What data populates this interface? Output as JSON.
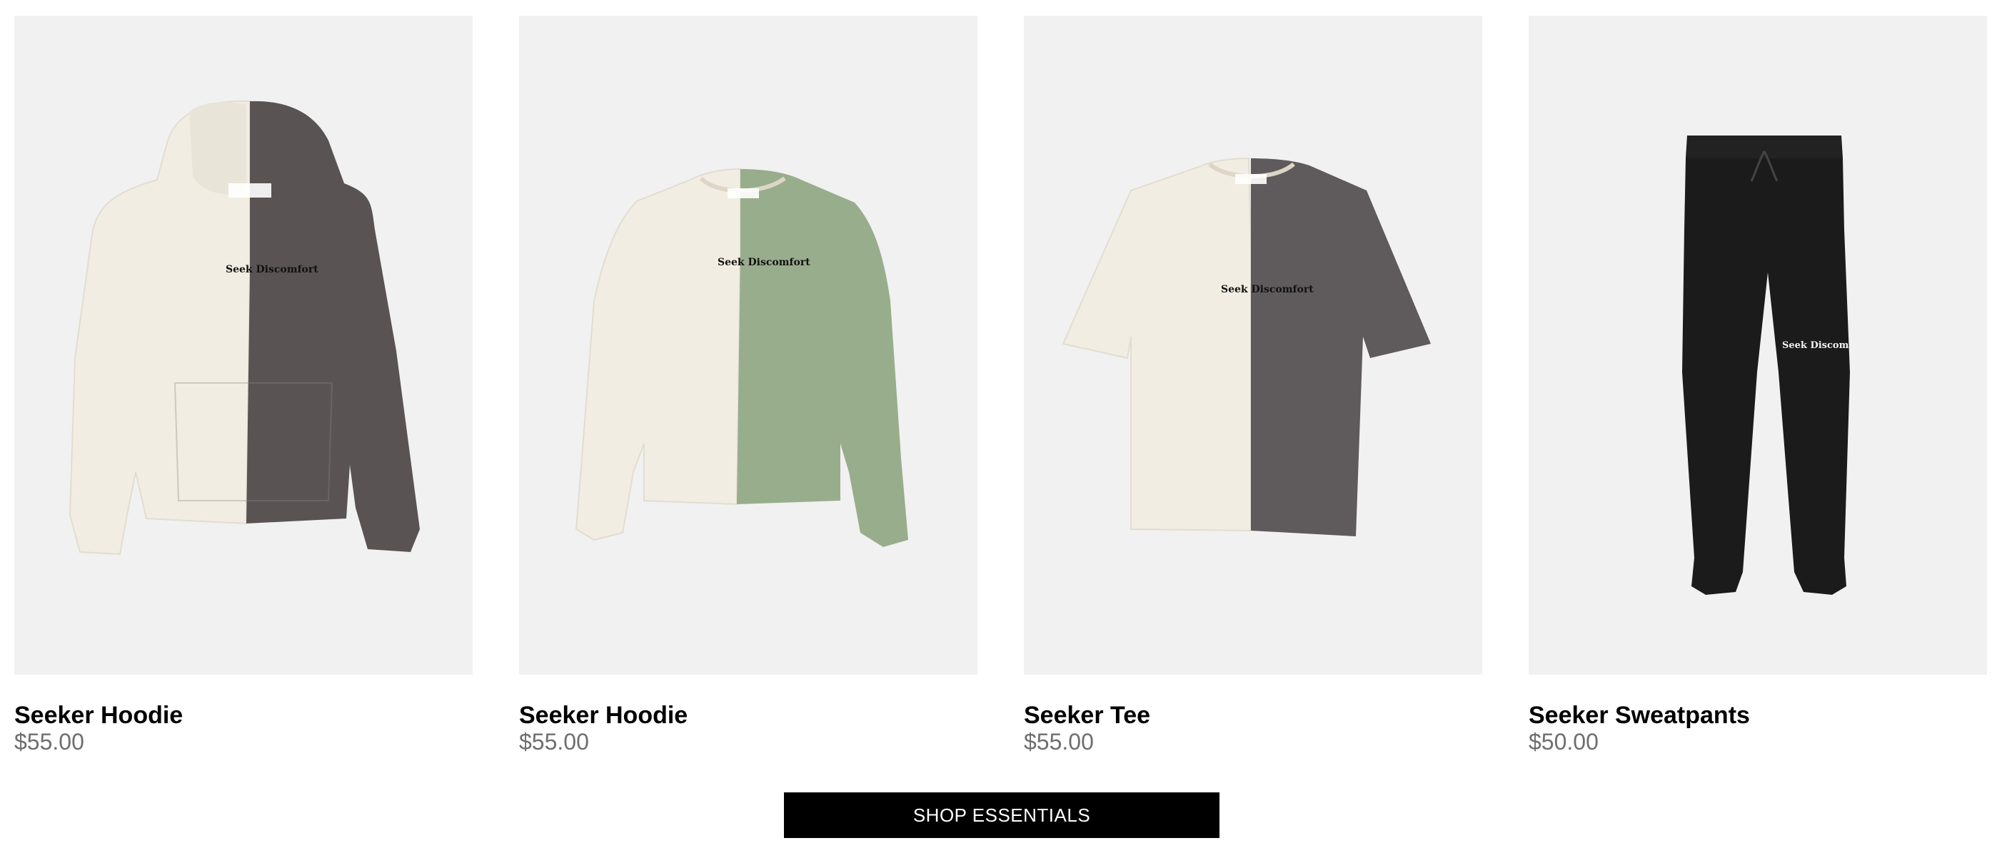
{
  "products": [
    {
      "name": "Seeker Hoodie",
      "price": "$55.00",
      "print_text": "Seek Discomfort",
      "garment": "hoodie",
      "colors": {
        "left": "#f1ede2",
        "right": "#595354"
      }
    },
    {
      "name": "Seeker Hoodie",
      "price": "$55.00",
      "print_text": "Seek Discomfort",
      "garment": "crewneck",
      "colors": {
        "left": "#f1ede2",
        "right": "#98ad8c"
      }
    },
    {
      "name": "Seeker Tee",
      "price": "$55.00",
      "print_text": "Seek Discomfort",
      "garment": "tee",
      "colors": {
        "left": "#f1ede2",
        "right": "#5f5a5b"
      }
    },
    {
      "name": "Seeker Sweatpants",
      "price": "$50.00",
      "print_text": "Seek Discomfort",
      "garment": "sweatpants",
      "colors": {
        "left": "#1b1b1b",
        "right": "#1b1b1b"
      }
    }
  ],
  "cta": {
    "label": "SHOP ESSENTIALS",
    "background": "#000000",
    "text_color": "#ffffff"
  },
  "theme": {
    "image_background": "#f1f1f1",
    "price_color": "#6e6e6e"
  }
}
